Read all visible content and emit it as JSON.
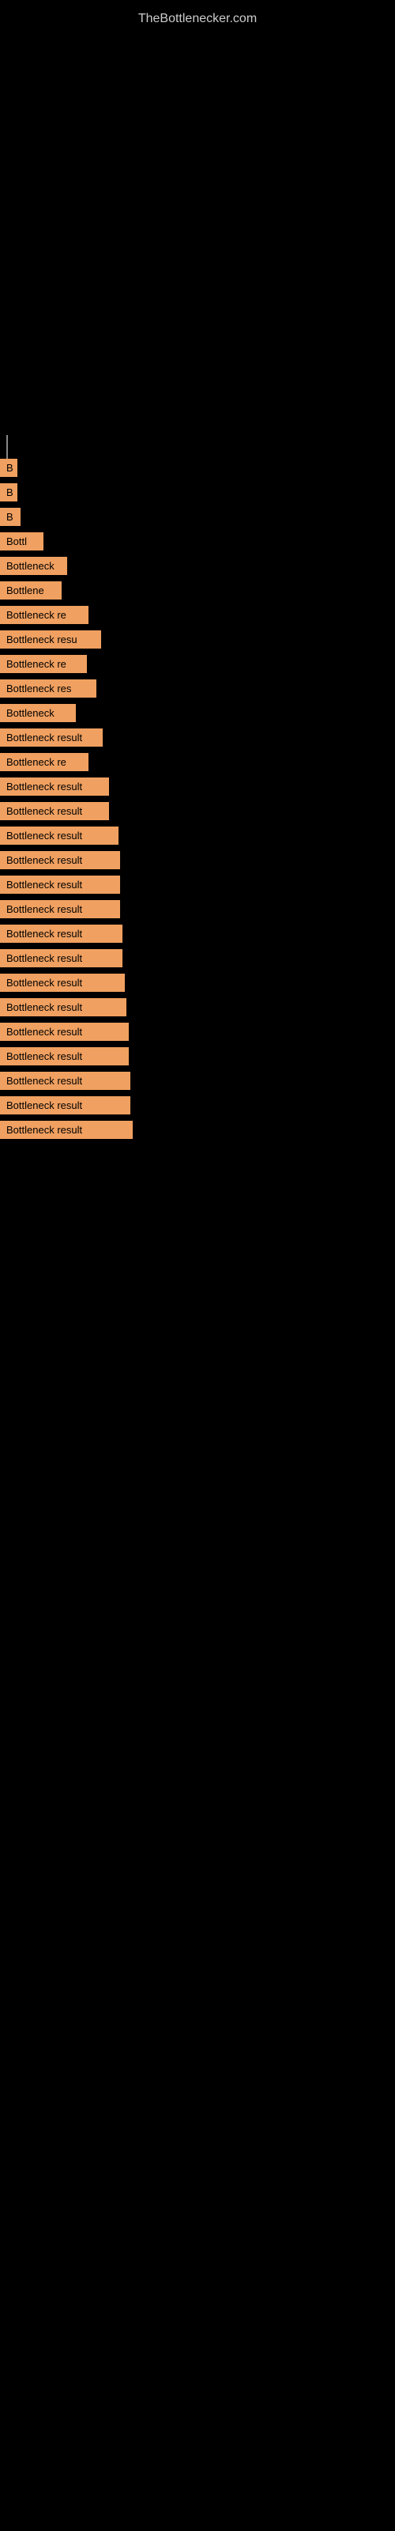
{
  "site": {
    "title": "TheBottlenecker.com"
  },
  "results": [
    {
      "id": 1,
      "label": "B",
      "width_class": "bar-1"
    },
    {
      "id": 2,
      "label": "B",
      "width_class": "bar-2"
    },
    {
      "id": 3,
      "label": "B",
      "width_class": "bar-3"
    },
    {
      "id": 4,
      "label": "Bottl",
      "width_class": "bar-4"
    },
    {
      "id": 5,
      "label": "Bottleneck",
      "width_class": "bar-5"
    },
    {
      "id": 6,
      "label": "Bottlene",
      "width_class": "bar-6"
    },
    {
      "id": 7,
      "label": "Bottleneck re",
      "width_class": "bar-7"
    },
    {
      "id": 8,
      "label": "Bottleneck resu",
      "width_class": "bar-8"
    },
    {
      "id": 9,
      "label": "Bottleneck re",
      "width_class": "bar-9"
    },
    {
      "id": 10,
      "label": "Bottleneck res",
      "width_class": "bar-10"
    },
    {
      "id": 11,
      "label": "Bottleneck",
      "width_class": "bar-11"
    },
    {
      "id": 12,
      "label": "Bottleneck result",
      "width_class": "bar-12"
    },
    {
      "id": 13,
      "label": "Bottleneck re",
      "width_class": "bar-13"
    },
    {
      "id": 14,
      "label": "Bottleneck result",
      "width_class": "bar-14"
    },
    {
      "id": 15,
      "label": "Bottleneck result",
      "width_class": "bar-15"
    },
    {
      "id": 16,
      "label": "Bottleneck result",
      "width_class": "bar-16"
    },
    {
      "id": 17,
      "label": "Bottleneck result",
      "width_class": "bar-17"
    },
    {
      "id": 18,
      "label": "Bottleneck result",
      "width_class": "bar-18"
    },
    {
      "id": 19,
      "label": "Bottleneck result",
      "width_class": "bar-19"
    },
    {
      "id": 20,
      "label": "Bottleneck result",
      "width_class": "bar-20"
    },
    {
      "id": 21,
      "label": "Bottleneck result",
      "width_class": "bar-21"
    },
    {
      "id": 22,
      "label": "Bottleneck result",
      "width_class": "bar-22"
    },
    {
      "id": 23,
      "label": "Bottleneck result",
      "width_class": "bar-23"
    },
    {
      "id": 24,
      "label": "Bottleneck result",
      "width_class": "bar-24"
    },
    {
      "id": 25,
      "label": "Bottleneck result",
      "width_class": "bar-25"
    },
    {
      "id": 26,
      "label": "Bottleneck result",
      "width_class": "bar-26"
    },
    {
      "id": 27,
      "label": "Bottleneck result",
      "width_class": "bar-27"
    },
    {
      "id": 28,
      "label": "Bottleneck result",
      "width_class": "bar-28"
    }
  ]
}
